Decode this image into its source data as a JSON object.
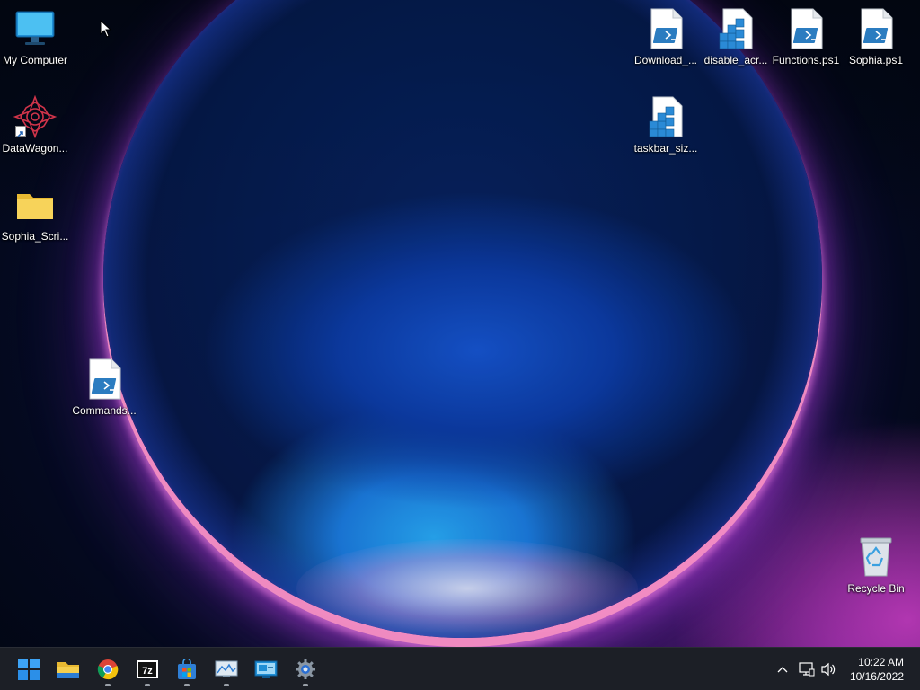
{
  "desktop": {
    "icons": [
      {
        "label": "My Computer",
        "icon": "monitor-icon"
      },
      {
        "label": "DataWagon...",
        "icon": "datawagon-logo-icon"
      },
      {
        "label": "Sophia_Scri...",
        "icon": "folder-icon"
      },
      {
        "label": "Commands...",
        "icon": "powershell-script-icon"
      },
      {
        "label": "Download_...",
        "icon": "powershell-script-icon"
      },
      {
        "label": "disable_acr...",
        "icon": "registry-file-icon"
      },
      {
        "label": "Functions.ps1",
        "icon": "powershell-script-icon"
      },
      {
        "label": "Sophia.ps1",
        "icon": "powershell-script-icon"
      },
      {
        "label": "taskbar_siz...",
        "icon": "registry-file-icon"
      },
      {
        "label": "Recycle Bin",
        "icon": "recycle-bin-icon"
      }
    ]
  },
  "taskbar": {
    "apps": [
      {
        "name": "Start",
        "icon": "windows-start-icon",
        "running": false
      },
      {
        "name": "File Explorer",
        "icon": "file-explorer-icon",
        "running": false
      },
      {
        "name": "Google Chrome",
        "icon": "chrome-icon",
        "running": true
      },
      {
        "name": "7-Zip",
        "icon": "7zip-icon",
        "running": true
      },
      {
        "name": "Microsoft Store",
        "icon": "store-icon",
        "running": true
      },
      {
        "name": "Performance Monitor",
        "icon": "performance-monitor-icon",
        "running": true
      },
      {
        "name": "Remote Desktop",
        "icon": "remote-desktop-icon",
        "running": false
      },
      {
        "name": "Settings",
        "icon": "settings-gear-icon",
        "running": true
      }
    ],
    "tray": {
      "icons": [
        "chevron-up-icon",
        "network-icon",
        "volume-icon"
      ],
      "time": "10:22 AM",
      "date": "10/16/2022"
    }
  },
  "colors": {
    "taskbar_bg": "#1c1f26",
    "accent_blue": "#1a78d8",
    "glow_pink": "#c43cbe"
  }
}
